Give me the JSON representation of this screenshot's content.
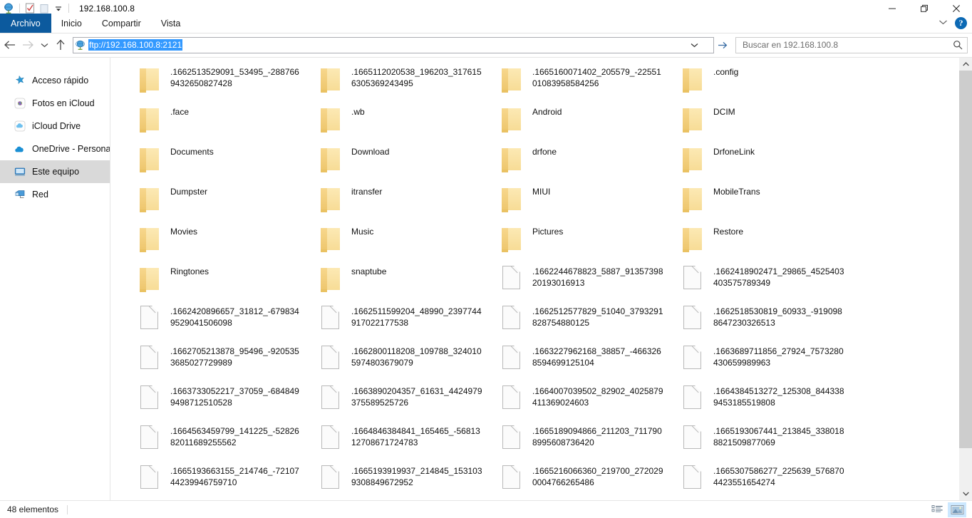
{
  "window": {
    "title": "192.168.100.8",
    "quick_access_icons": [
      "explorer-icon",
      "properties-icon",
      "new-folder-icon",
      "customize-qat-icon"
    ],
    "controls": {
      "minimize": "minimize-icon",
      "maximize": "maximize-icon",
      "close": "close-icon"
    }
  },
  "ribbon": {
    "tabs": [
      {
        "label": "Archivo",
        "selected": true
      },
      {
        "label": "Inicio",
        "selected": false
      },
      {
        "label": "Compartir",
        "selected": false
      },
      {
        "label": "Vista",
        "selected": false
      }
    ],
    "collapse_icon": "chevron-down-icon",
    "help_label": "?"
  },
  "navbar": {
    "back": "back-arrow-icon",
    "forward": "forward-arrow-icon",
    "recent": "chevron-down-icon",
    "up": "up-arrow-icon",
    "address": {
      "icon": "network-globe-icon",
      "prefix": "ftp://",
      "selected_text": "192.168.100.8:2121",
      "full_value": "ftp://192.168.100.8:2121",
      "dropdown_icon": "chevron-down-icon",
      "go_icon": "go-arrow-icon"
    },
    "search": {
      "placeholder": "Buscar en 192.168.100.8",
      "value": "",
      "icon": "search-icon"
    }
  },
  "sidebar": {
    "items": [
      {
        "label": "Acceso rápido",
        "icon": "star-pin-icon",
        "selected": false
      },
      {
        "label": "Fotos en iCloud",
        "icon": "icloud-photos-icon",
        "selected": false
      },
      {
        "label": "iCloud Drive",
        "icon": "icloud-drive-icon",
        "selected": false
      },
      {
        "label": "OneDrive - Personal",
        "icon": "onedrive-cloud-icon",
        "selected": false
      },
      {
        "label": "Este equipo",
        "icon": "this-pc-icon",
        "selected": true
      },
      {
        "label": "Red",
        "icon": "network-icon",
        "selected": false
      }
    ]
  },
  "files": [
    {
      "name": ".1662513529091_53495_-2887669432650827428",
      "type": "folder"
    },
    {
      "name": ".1665112020538_196203_3176156305369243495",
      "type": "folder"
    },
    {
      "name": ".1665160071402_205579_-2255101083958584256",
      "type": "folder"
    },
    {
      "name": ".config",
      "type": "folder"
    },
    {
      "name": ".face",
      "type": "folder"
    },
    {
      "name": ".wb",
      "type": "folder"
    },
    {
      "name": "Android",
      "type": "folder"
    },
    {
      "name": "DCIM",
      "type": "folder"
    },
    {
      "name": "Documents",
      "type": "folder"
    },
    {
      "name": "Download",
      "type": "folder"
    },
    {
      "name": "drfone",
      "type": "folder"
    },
    {
      "name": "DrfoneLink",
      "type": "folder"
    },
    {
      "name": "Dumpster",
      "type": "folder"
    },
    {
      "name": "itransfer",
      "type": "folder"
    },
    {
      "name": "MIUI",
      "type": "folder"
    },
    {
      "name": "MobileTrans",
      "type": "folder"
    },
    {
      "name": "Movies",
      "type": "folder"
    },
    {
      "name": "Music",
      "type": "folder"
    },
    {
      "name": "Pictures",
      "type": "folder"
    },
    {
      "name": "Restore",
      "type": "folder"
    },
    {
      "name": "Ringtones",
      "type": "folder"
    },
    {
      "name": "snaptube",
      "type": "folder"
    },
    {
      "name": ".1662244678823_5887_9135739820193016913",
      "type": "file"
    },
    {
      "name": ".1662418902471_29865_4525403403575789349",
      "type": "file"
    },
    {
      "name": ".1662420896657_31812_-6798349529041506098",
      "type": "file"
    },
    {
      "name": ".1662511599204_48990_2397744917022177538",
      "type": "file"
    },
    {
      "name": ".1662512577829_51040_3793291828754880125",
      "type": "file"
    },
    {
      "name": ".1662518530819_60933_-9190988647230326513",
      "type": "file"
    },
    {
      "name": ".1662705213878_95496_-9205353685027729989",
      "type": "file"
    },
    {
      "name": ".1662800118208_109788_3240105974803679079",
      "type": "file"
    },
    {
      "name": ".1663227962168_38857_-4663268594699125104",
      "type": "file"
    },
    {
      "name": ".1663689711856_27924_7573280430659989963",
      "type": "file"
    },
    {
      "name": ".1663733052217_37059_-6848499498712510528",
      "type": "file"
    },
    {
      "name": ".1663890204357_61631_4424979375589525726",
      "type": "file"
    },
    {
      "name": ".1664007039502_82902_4025879411369024603",
      "type": "file"
    },
    {
      "name": ".1664384513272_125308_8443389453185519808",
      "type": "file"
    },
    {
      "name": ".1664563459799_141225_-5282682011689255562",
      "type": "file"
    },
    {
      "name": ".1664846384841_165465_-5681312708671724783",
      "type": "file"
    },
    {
      "name": ".1665189094866_211203_7117908995608736420",
      "type": "file"
    },
    {
      "name": ".1665193067441_213845_3380188821509877069",
      "type": "file"
    },
    {
      "name": ".1665193663155_214746_-7210744239946759710",
      "type": "file"
    },
    {
      "name": ".1665193919937_214845_1531039308849672952",
      "type": "file"
    },
    {
      "name": ".1665216066360_219700_2720290004766265486",
      "type": "file"
    },
    {
      "name": ".1665307586277_225639_5768704423551654274",
      "type": "file"
    }
  ],
  "statusbar": {
    "item_count": "48 elementos",
    "views": [
      {
        "name": "details-view-button",
        "active": false
      },
      {
        "name": "large-icons-view-button",
        "active": true
      }
    ]
  },
  "colors": {
    "accent": "#0c5a9e",
    "selection": "#3399ff",
    "folder": "#f7d78d",
    "sidebar_selected": "#d9d9d9",
    "help_blue": "#0c69b4"
  }
}
